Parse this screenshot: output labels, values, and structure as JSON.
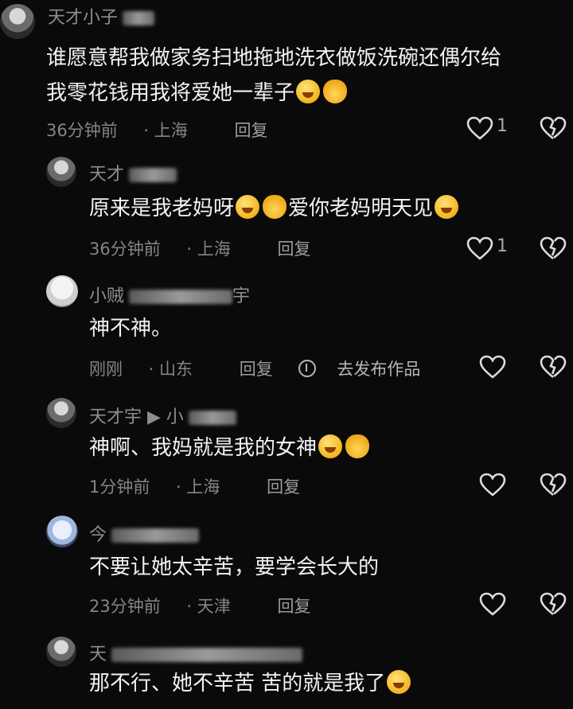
{
  "comments": [
    {
      "name": "天才小子",
      "text_lines": [
        "谁愿意帮我做家务扫地拖地洗衣做饭洗碗还偶尔给",
        "我零花钱用我将爱她一辈子"
      ],
      "emojis": [
        "grin-emoji",
        "ok-hand-emoji"
      ],
      "time": "36分钟前",
      "location": "上海",
      "reply": "回复",
      "likes": "1"
    },
    {
      "name": "天才",
      "text": "原来是我老妈呀",
      "text_after": "爱你老妈明天见",
      "time": "36分钟前",
      "location": "上海",
      "reply": "回复",
      "likes": "1"
    },
    {
      "name": "小贼",
      "name_tail": "宇",
      "text": "神不神。",
      "time": "刚刚",
      "location": "山东",
      "reply": "回复",
      "publish": "去发布作品"
    },
    {
      "name": "天才宇",
      "name_mid": "▶ 小",
      "text": "神啊、我妈就是我的女神",
      "time": "1分钟前",
      "location": "上海",
      "reply": "回复"
    },
    {
      "name": "今",
      "text": "不要让她太辛苦，要学会长大的",
      "time": "23分钟前",
      "location": "天津",
      "reply": "回复"
    },
    {
      "name": "天",
      "text": "那不行、她不辛苦 苦的就是我了"
    }
  ]
}
